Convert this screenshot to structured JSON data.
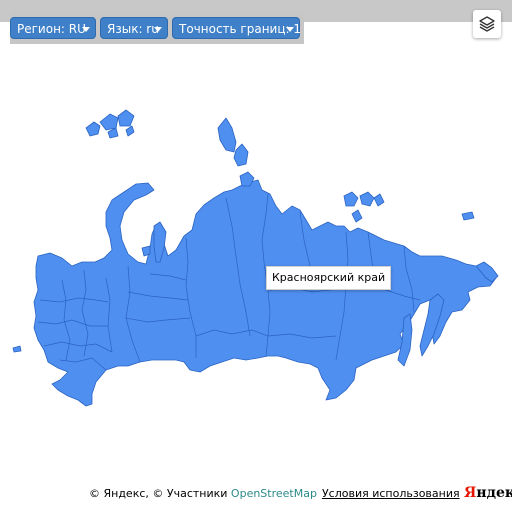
{
  "controls": {
    "region_label": "Регион: RU",
    "language_label": "Язык: ru",
    "precision_label": "Точность границ: 1"
  },
  "map": {
    "region_fill": "#4f8ff0",
    "region_border": "#2a63c2",
    "tooltip": "Красноярский край"
  },
  "footer": {
    "copyright_prefix": "© Яндекс, © Участники ",
    "osm_link": "OpenStreetMap",
    "terms_link": "Условия использования",
    "logo_first": "Я",
    "logo_rest": "ндекс"
  },
  "icons": {
    "layers": "layers-icon"
  }
}
